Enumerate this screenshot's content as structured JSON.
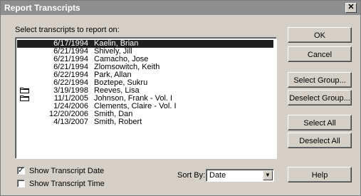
{
  "window": {
    "title": "Report Transcripts",
    "close_glyph": "✕"
  },
  "list": {
    "label": "Select transcripts to report on:",
    "rows": [
      {
        "date": "6/17/1994",
        "name": "Kaelin, Brian",
        "selected": true,
        "folder": false
      },
      {
        "date": "6/21/1994",
        "name": "Shively, Jill",
        "selected": false,
        "folder": false
      },
      {
        "date": "6/21/1994",
        "name": "Camacho, Jose",
        "selected": false,
        "folder": false
      },
      {
        "date": "6/21/1994",
        "name": "Zlomsowitch, Keith",
        "selected": false,
        "folder": false
      },
      {
        "date": "6/22/1994",
        "name": "Park, Allan",
        "selected": false,
        "folder": false
      },
      {
        "date": "6/22/1994",
        "name": "Boztepe, Sukru",
        "selected": false,
        "folder": false
      },
      {
        "date": "3/19/1998",
        "name": "Reeves, Lisa",
        "selected": false,
        "folder": true
      },
      {
        "date": "11/1/2005",
        "name": "Johnson, Frank - Vol. I",
        "selected": false,
        "folder": true
      },
      {
        "date": "1/24/2006",
        "name": "Clements, Claire - Vol. I",
        "selected": false,
        "folder": false
      },
      {
        "date": "12/20/2006",
        "name": "Smith, Dan",
        "selected": false,
        "folder": false
      },
      {
        "date": "4/13/2007",
        "name": "Smith, Robert",
        "selected": false,
        "folder": false
      }
    ]
  },
  "buttons": {
    "ok": "OK",
    "cancel": "Cancel",
    "select_group": "Select Group...",
    "deselect_group": "Deselect Group...",
    "select_all": "Select All",
    "deselect_all": "Deselect All",
    "help": "Help"
  },
  "options": {
    "show_date_label": "Show Transcript Date",
    "show_date_checked": true,
    "show_time_label": "Show Transcript Time",
    "show_time_checked": false,
    "check_glyph": "✓",
    "sort_by_label": "Sort By:",
    "sort_by_value": "Date",
    "dropdown_glyph": "▼"
  }
}
